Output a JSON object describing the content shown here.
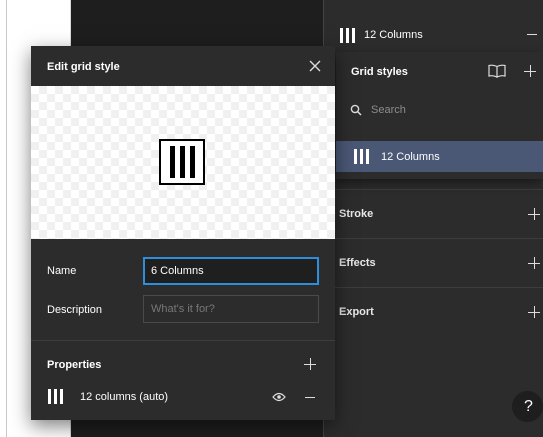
{
  "layout_grid": {
    "label": "12 Columns"
  },
  "grid_styles_popover": {
    "title": "Grid styles",
    "search_placeholder": "Search",
    "items": [
      {
        "label": "12 Columns",
        "selected": true
      }
    ]
  },
  "sections": [
    {
      "label": "Stroke"
    },
    {
      "label": "Effects"
    },
    {
      "label": "Export"
    }
  ],
  "edit_modal": {
    "title": "Edit grid style",
    "name_label": "Name",
    "name_value": "6 Columns",
    "description_label": "Description",
    "description_placeholder": "What's it for?",
    "properties_title": "Properties",
    "properties": [
      {
        "label": "12 columns (auto)"
      }
    ]
  },
  "help": {
    "label": "?"
  },
  "colors": {
    "panel_bg": "#2c2c2c",
    "selected_item_bg": "#4a5775",
    "focus_border": "#2f8edb"
  },
  "icons": [
    "grid-columns-icon",
    "book-icon",
    "plus-icon",
    "minus-icon",
    "search-icon",
    "close-icon",
    "eye-icon"
  ]
}
